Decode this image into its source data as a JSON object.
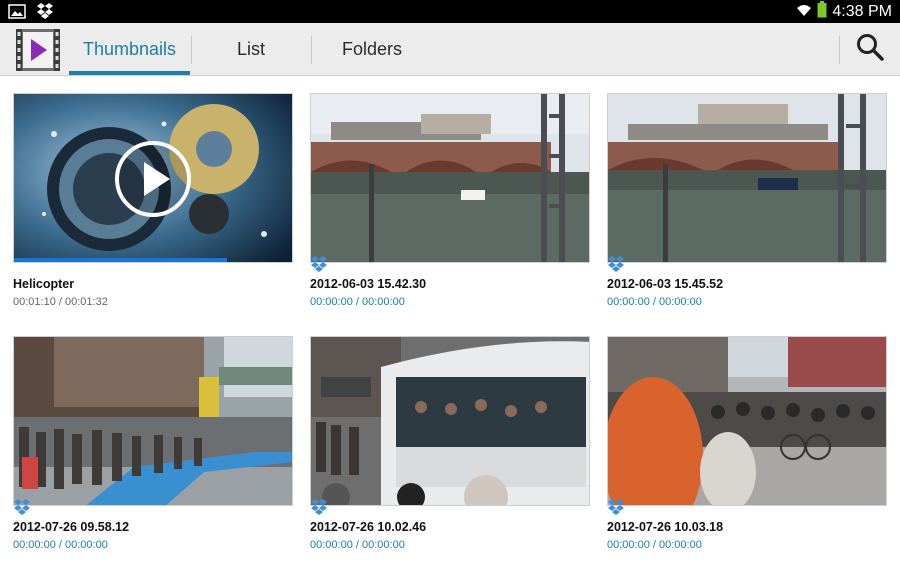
{
  "status_bar": {
    "left_icons": [
      "image-icon",
      "dropbox-icon"
    ],
    "right_icons": [
      "wifi-icon",
      "battery-icon"
    ],
    "time": "4:38 PM"
  },
  "action_bar": {
    "app_icon": "video-player-icon",
    "tabs": [
      {
        "label": "Thumbnails",
        "active": true
      },
      {
        "label": "List",
        "active": false
      },
      {
        "label": "Folders",
        "active": false
      }
    ],
    "search_icon": "search-icon"
  },
  "colors": {
    "accent": "#1c7fa8",
    "progress": "#1a73d6",
    "dropbox": "#3d8fd9"
  },
  "videos": [
    {
      "title": "Helicopter",
      "duration": "00:01:10 / 00:01:32",
      "progress": 0.76,
      "playing": true,
      "dropbox": false
    },
    {
      "title": "2012-06-03 15.42.30",
      "duration": "00:00:00 / 00:00:00",
      "dropbox": true
    },
    {
      "title": "2012-06-03 15.45.52",
      "duration": "00:00:00 / 00:00:00",
      "dropbox": true
    },
    {
      "title": "2012-07-26 09.58.12",
      "duration": "00:00:00 / 00:00:00",
      "dropbox": true
    },
    {
      "title": "2012-07-26 10.02.46",
      "duration": "00:00:00 / 00:00:00",
      "dropbox": true
    },
    {
      "title": "2012-07-26 10.03.18",
      "duration": "00:00:00 / 00:00:00",
      "dropbox": true
    }
  ]
}
